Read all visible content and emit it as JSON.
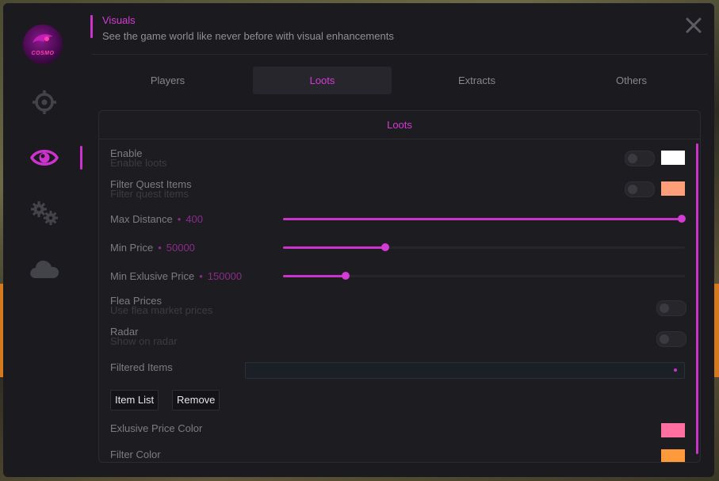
{
  "header": {
    "title": "Visuals",
    "subtitle": "See the game world like never before with visual enhancements"
  },
  "logo": {
    "text": "COSMO"
  },
  "sidebar": {
    "items": [
      {
        "icon": "crosshair-icon",
        "active": false
      },
      {
        "icon": "eye-icon",
        "active": true
      },
      {
        "icon": "gears-icon",
        "active": false
      },
      {
        "icon": "cloud-icon",
        "active": false
      }
    ]
  },
  "tabs": [
    {
      "label": "Players",
      "active": false
    },
    {
      "label": "Loots",
      "active": true
    },
    {
      "label": "Extracts",
      "active": false
    },
    {
      "label": "Others",
      "active": false
    }
  ],
  "panel": {
    "title": "Loots",
    "enable": {
      "label": "Enable",
      "description": "Enable loots",
      "on": false,
      "color": "#ffffff"
    },
    "filter_quest": {
      "label": "Filter Quest Items",
      "description": "Filter quest items",
      "on": false,
      "color": "#ff9f7a"
    },
    "max_distance": {
      "label": "Max Distance",
      "value": "400",
      "fraction": 1.0
    },
    "min_price": {
      "label": "Min Price",
      "value": "50000",
      "fraction": 0.255
    },
    "min_exlusive_price": {
      "label": "Min Exlusive Price",
      "value": "150000",
      "fraction": 0.155
    },
    "flea_prices": {
      "label": "Flea Prices",
      "description": "Use flea market prices",
      "on": false
    },
    "radar": {
      "label": "Radar",
      "description": "Show on radar",
      "on": false
    },
    "filtered_items": {
      "label": "Filtered Items",
      "value": ""
    },
    "item_list_button": "Item List",
    "remove_button": "Remove",
    "exlusive_price_color": {
      "label": "Exlusive Price Color",
      "color": "#ff6fa0"
    },
    "filter_color": {
      "label": "Filter Color",
      "color": "#ff9a3a"
    }
  }
}
